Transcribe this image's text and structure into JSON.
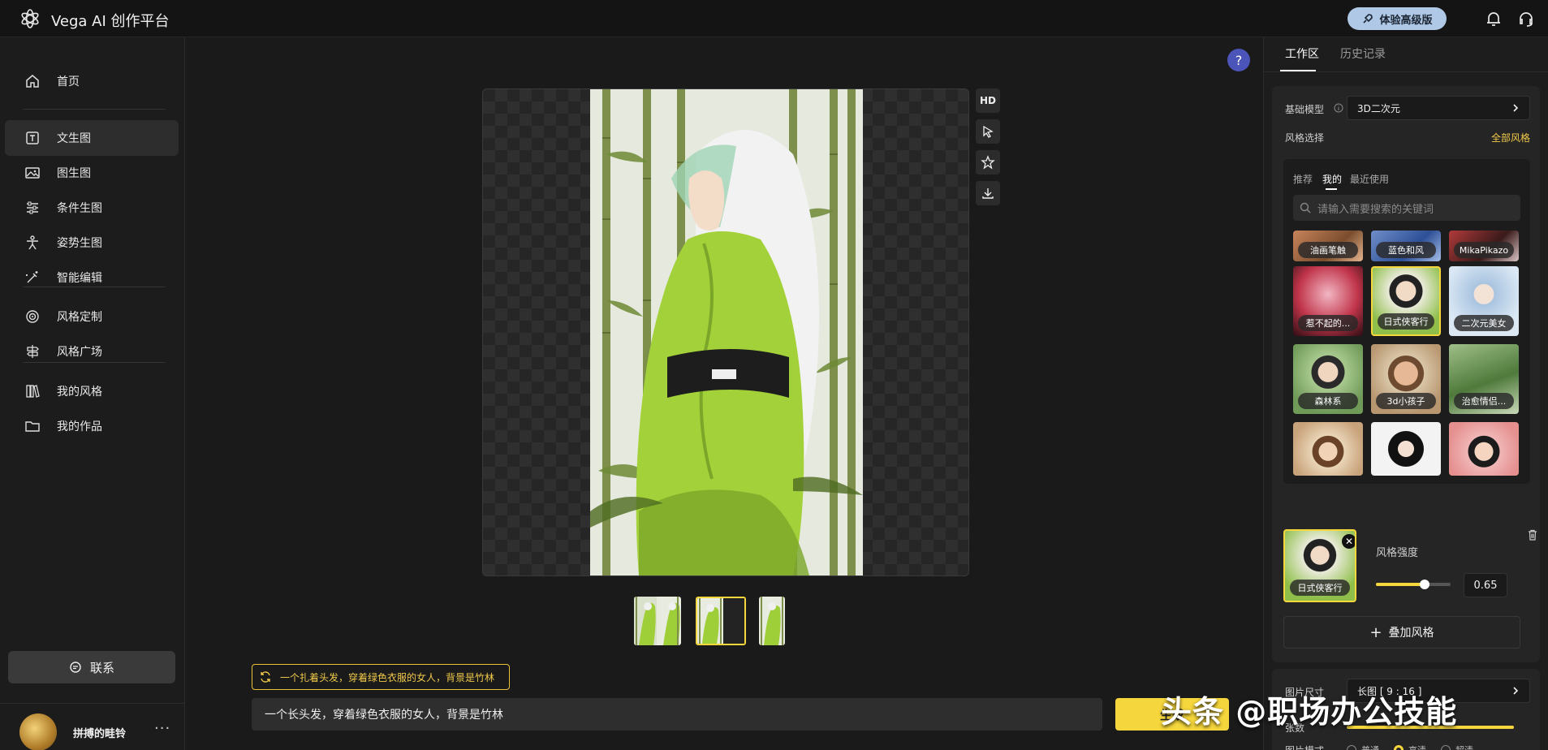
{
  "app": {
    "title": "Vega AI 创作平台",
    "upgrade_label": "体验高级版"
  },
  "sidebar": {
    "items": [
      {
        "label": "首页",
        "icon": "home-icon"
      },
      {
        "label": "文生图",
        "icon": "text-box-icon"
      },
      {
        "label": "图生图",
        "icon": "image-icon"
      },
      {
        "label": "条件生图",
        "icon": "sliders-icon"
      },
      {
        "label": "姿势生图",
        "icon": "pose-icon"
      },
      {
        "label": "智能编辑",
        "icon": "magic-edit-icon"
      },
      {
        "label": "风格定制",
        "icon": "target-icon"
      },
      {
        "label": "风格广场",
        "icon": "signpost-icon"
      },
      {
        "label": "我的风格",
        "icon": "books-icon"
      },
      {
        "label": "我的作品",
        "icon": "folder-icon"
      }
    ],
    "active_item": "文生图",
    "contact_label": "联系",
    "user": {
      "name": "拼搏的畦铃",
      "more": "···"
    }
  },
  "canvas": {
    "help": "?",
    "tools": [
      "HD"
    ],
    "thumbnail_count": 3,
    "selected_thumbnail": 2
  },
  "prompt": {
    "suggestion": "一个扎着头发，穿着绿色衣服的女人，背景是竹林",
    "value": "一个长头发，穿着绿色衣服的女人，背景是竹林",
    "generate_label": "生成"
  },
  "right_panel": {
    "tabs": [
      "工作区",
      "历史记录"
    ],
    "active_tab": "工作区",
    "base_model": {
      "label": "基础模型",
      "value": "3D二次元"
    },
    "style_select": {
      "label": "风格选择",
      "all_link": "全部风格",
      "sub_tabs": [
        "推荐",
        "我的",
        "最近使用"
      ],
      "active_sub_tab": "我的",
      "search_placeholder": "请输入需要搜索的关键词",
      "tiles": [
        {
          "label": "油画笔触"
        },
        {
          "label": "蓝色和风"
        },
        {
          "label": "MikaPikazo"
        },
        {
          "label": "惹不起的..."
        },
        {
          "label": "日式侠客行"
        },
        {
          "label": "二次元美女"
        },
        {
          "label": "森林系"
        },
        {
          "label": "3d小孩子"
        },
        {
          "label": "治愈情侣..."
        },
        {
          "label": ""
        },
        {
          "label": ""
        },
        {
          "label": ""
        }
      ]
    },
    "applied_style": {
      "name": "日式侠客行",
      "strength_label": "风格强度",
      "strength_value": "0.65",
      "strength": 0.65
    },
    "add_style_label": "叠加风格",
    "image_size": {
      "label": "图片尺寸",
      "value": "长图 [ 9 : 16 ]"
    },
    "count_label": "张数",
    "image_mode": {
      "label": "图片模式",
      "options": [
        "普通",
        "高清",
        "超清"
      ],
      "selected": "高清"
    }
  },
  "watermark": "头条 @职场办公技能",
  "colors": {
    "accent": "#f5d63c",
    "upgrade_bg": "#aec8e6",
    "help_bg": "#4b54b8"
  }
}
